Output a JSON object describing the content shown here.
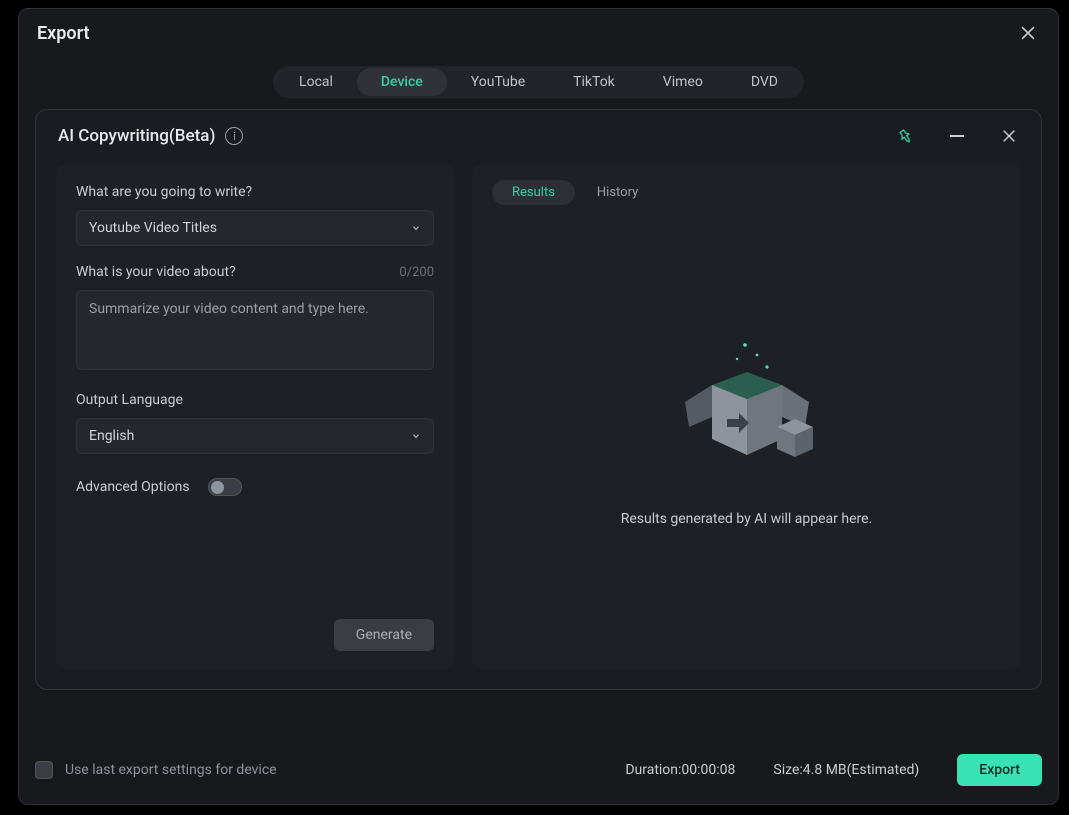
{
  "window": {
    "title": "Export",
    "tabs": [
      "Local",
      "Device",
      "YouTube",
      "TikTok",
      "Vimeo",
      "DVD"
    ],
    "active_tab_index": 1
  },
  "ai_panel": {
    "title": "AI Copywriting(Beta)",
    "write_label": "What are you going to write?",
    "write_select": "Youtube Video Titles",
    "about_label": "What is your video about?",
    "about_counter": "0/200",
    "about_placeholder": "Summarize your video content and type here.",
    "lang_label": "Output Language",
    "lang_select": "English",
    "advanced_label": "Advanced Options",
    "advanced_on": false,
    "generate_label": "Generate",
    "right_tabs": {
      "results": "Results",
      "history": "History"
    },
    "empty_text": "Results generated by AI will appear here."
  },
  "footer": {
    "use_last_label": "Use last export settings for device",
    "duration_label": "Duration:",
    "duration_value": "00:00:08",
    "size_label": "Size:",
    "size_value": "4.8 MB(Estimated)",
    "export_label": "Export"
  },
  "colors": {
    "accent": "#35d0a5",
    "export_btn": "#39e2b3"
  }
}
